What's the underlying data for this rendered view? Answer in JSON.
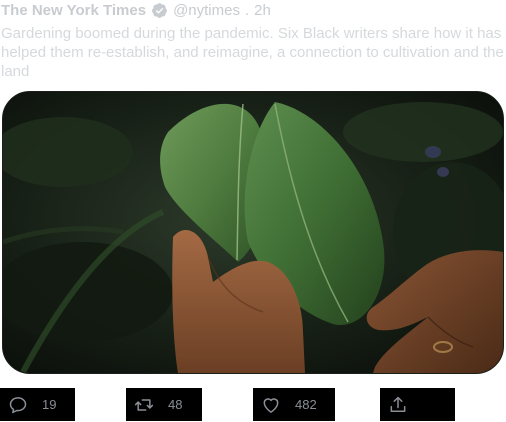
{
  "author": {
    "name": "The New York Times",
    "handle": "@nytimes",
    "separator": ".",
    "time": "2h",
    "verified": true
  },
  "tweet": {
    "text": "Gardening boomed during the pandemic. Six Black writers share how it has helped them re-establish, and reimagine, a connection to cultivation and the land"
  },
  "media": {
    "icon": "photo-of-hands-holding-green-leaves"
  },
  "actions": {
    "reply": {
      "icon": "reply-icon",
      "count": "19"
    },
    "retweet": {
      "icon": "retweet-icon",
      "count": "48"
    },
    "like": {
      "icon": "heart-icon",
      "count": "482"
    },
    "share": {
      "icon": "share-icon"
    }
  },
  "colors": {
    "muted_text": "#c8ccd0",
    "action_bar_bg": "#000000",
    "action_count": "#8a8f96"
  }
}
